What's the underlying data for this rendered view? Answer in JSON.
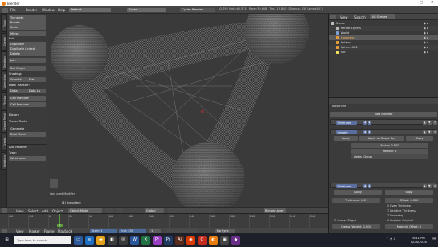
{
  "window": {
    "title": "Blender",
    "controls": [
      "–",
      "▢",
      "✕"
    ]
  },
  "menu": [
    "File",
    "Render",
    "Window",
    "Help"
  ],
  "screen_layout": "Default",
  "scene_name": "Scene",
  "render_engine": "Cycles Render",
  "stats": "Time:00:02.04 | Remaining:00:01.39 | Mem:40.70M, Peak:40.71M | Path Tracing Sample 1/16",
  "stats_right": "v2.79 | Verts:60,575 | Faces:59,658 | Tris:119,800 | Objects:1/3 | Lamps:0/1 | Mem:32.02M | Icosphere",
  "left_tabs": [
    "Tools",
    "Create",
    "Relations",
    "Animation",
    "Physics",
    "Grease Pencil",
    "Create",
    "Relations",
    "Animation",
    "Physics"
  ],
  "toolshelf": {
    "transform_items": [
      "Translate",
      "Rotate",
      "Scale",
      "Mirror"
    ],
    "edit_header": "Edit",
    "edit_items": [
      "Duplicate",
      "Duplicate Linked",
      "Delete",
      "Join"
    ],
    "origin_label": "Set Origin",
    "shading_label": "Shading:",
    "smooth": "Smooth",
    "flat": "Flat",
    "data_transfer_label": "Data Transfer:",
    "data": "Data",
    "data_layout": "Data La",
    "cell_fracture_1": "Cell Fracture",
    "cell_fracture_2": "Cell Fracture",
    "history_header": "History",
    "tissue_header": "Tissue Tools",
    "generate_label": "Generate",
    "dual_mesh": "Dual Mesh"
  },
  "operator_panel": {
    "title": "Add Modifier",
    "type_label": "Type:",
    "type_value": "Wireframe"
  },
  "viewport": {
    "object_label": "(1) Icosphere",
    "last_op": "Last used Modifier"
  },
  "vp_header": {
    "view": "View",
    "select": "Select",
    "add": "Add",
    "object": "Object",
    "mode": "Object Mode",
    "pivot": "Global",
    "layer": "RenderLayer"
  },
  "timeline": {
    "ticks": [
      "-40",
      "-20",
      "0",
      "20",
      "40",
      "60",
      "80",
      "100",
      "120",
      "140",
      "160",
      "180",
      "200",
      "220",
      "240",
      "260"
    ],
    "marker_frame": "0"
  },
  "tl_header": {
    "view": "View",
    "marker": "Marker",
    "frame": "Frame",
    "playback": "Playback",
    "start": "Start:",
    "start_val": "1",
    "end": "End:",
    "end_val": "250",
    "current": "1",
    "sync": "No Sync"
  },
  "outliner": {
    "view": "View",
    "search": "Search",
    "filter": "All Scenes",
    "items": [
      {
        "name": "Scene",
        "indent": 0,
        "icon": "scene"
      },
      {
        "name": "RenderLayers",
        "indent": 1,
        "icon": "renderlayer"
      },
      {
        "name": "World",
        "indent": 1,
        "icon": "world"
      },
      {
        "name": "Icosphere",
        "indent": 1,
        "icon": "mesh",
        "selected": true
      },
      {
        "name": "Sphere",
        "indent": 1,
        "icon": "mesh"
      },
      {
        "name": "Sphere.002",
        "indent": 1,
        "icon": "mesh"
      },
      {
        "name": "Sun",
        "indent": 1,
        "icon": "lamp"
      }
    ]
  },
  "properties": {
    "object_name": "Icosphere",
    "add_modifier": "Add Modifier",
    "modifiers": [
      {
        "name": "Wireframe",
        "collapsed": true
      },
      {
        "name": "Smooth",
        "collapsed": false
      }
    ],
    "smooth": {
      "apply": "Apply",
      "apply_shape": "Apply as Shape Key",
      "copy": "Copy",
      "factor_label": "Factor:",
      "factor": "0.500",
      "repeat_label": "Repeat:",
      "repeat": "5",
      "vgroup": "Vertex Group"
    },
    "wireframe": {
      "name": "Wireframe",
      "apply": "Apply",
      "copy": "Copy",
      "thickness_label": "Thickness:",
      "thickness": "0.02",
      "offset_label": "Offset:",
      "offset": "0.000",
      "even": "Even Thickness",
      "relative": "Relative Thickness",
      "boundary": "Boundary",
      "replace": "Replace Original",
      "crease": "Crease Edges",
      "crease_weight_label": "Crease Weight:",
      "crease_weight": "1.000",
      "material_offset_label": "Material Offset:",
      "material_offset": "0"
    }
  },
  "taskbar": {
    "time": "6:41 PM",
    "date": "6/28/2018",
    "search_placeholder": "Type here to search"
  },
  "colors": {
    "accent": "#e87d0d",
    "selection": "#ffb35c",
    "modifier_blue": "#5a6fa0",
    "taskbar": "#1d1f29"
  }
}
